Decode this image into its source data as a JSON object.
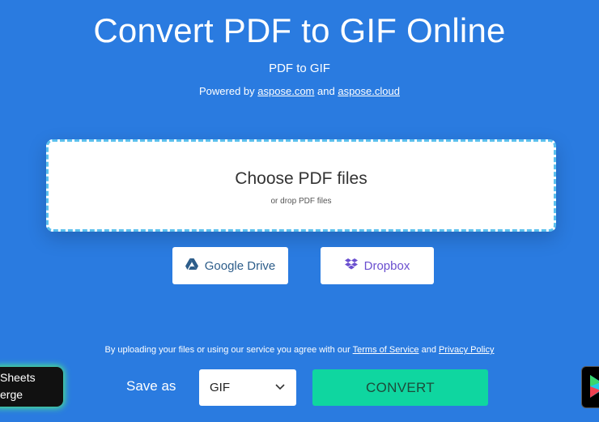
{
  "header": {
    "title": "Convert PDF to GIF Online",
    "subtitle": "PDF to GIF",
    "powered_prefix": "Powered by",
    "powered_link1": "aspose.com",
    "powered_and": "and",
    "powered_link2": "aspose.cloud"
  },
  "dropzone": {
    "choose_label": "Choose PDF files",
    "drop_label": "or drop PDF files"
  },
  "cloud_buttons": {
    "google_drive": "Google Drive",
    "dropbox": "Dropbox"
  },
  "terms": {
    "prefix": "By uploading your files or using our service you agree with our",
    "terms_link": "Terms of Service",
    "and": "and",
    "privacy_link": "Privacy Policy"
  },
  "save": {
    "label": "Save as",
    "selected_format": "GIF",
    "convert_label": "CONVERT"
  },
  "promo_left": {
    "line1": "Sheets",
    "line2": "erge"
  },
  "colors": {
    "background": "#2a7be0",
    "convert": "#0fd6a0",
    "dropzone_border": "#5bc0ee"
  }
}
